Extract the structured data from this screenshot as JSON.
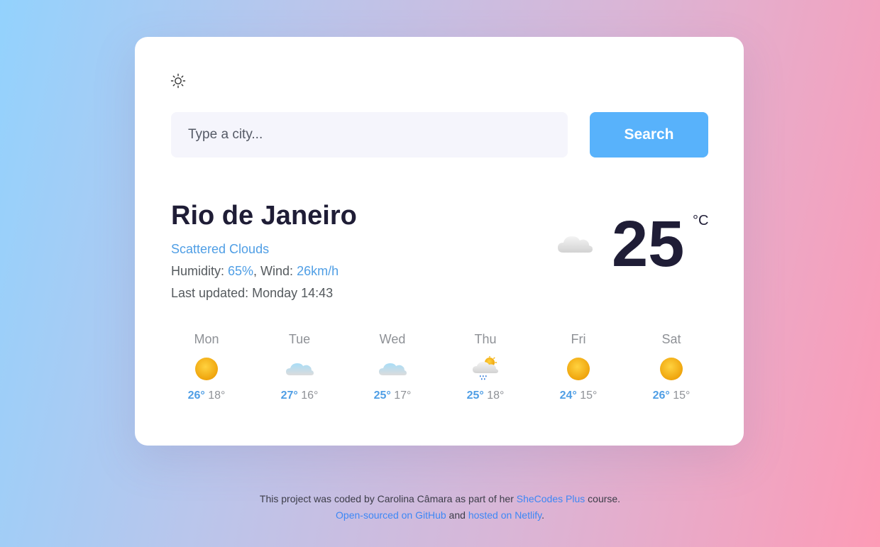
{
  "theme_toggle": {
    "icon": "sun-outline-icon"
  },
  "search": {
    "placeholder": "Type a city...",
    "button_label": "Search"
  },
  "current": {
    "city": "Rio de Janeiro",
    "description": "Scattered Clouds",
    "humidity_label": "Humidity: ",
    "humidity_value": "65%",
    "wind_label": ", Wind: ",
    "wind_value": "26km/h",
    "updated": "Last updated: Monday 14:43",
    "icon": "cloud-icon",
    "temperature": "25",
    "unit": "°C"
  },
  "forecast": [
    {
      "day": "Mon",
      "icon": "sun-icon",
      "max": "26°",
      "min": "18°"
    },
    {
      "day": "Tue",
      "icon": "cloud-icon",
      "max": "27°",
      "min": "16°"
    },
    {
      "day": "Wed",
      "icon": "cloud-icon",
      "max": "25°",
      "min": "17°"
    },
    {
      "day": "Thu",
      "icon": "sun-cloud-rain-icon",
      "max": "25°",
      "min": "18°"
    },
    {
      "day": "Fri",
      "icon": "sun-icon",
      "max": "24°",
      "min": "15°"
    },
    {
      "day": "Sat",
      "icon": "sun-icon",
      "max": "26°",
      "min": "15°"
    }
  ],
  "footer": {
    "line1_prefix": "This project was coded by Carolina Câmara as part of her ",
    "shecodes_link": "SheCodes Plus",
    "line1_suffix": " course.",
    "github_link": "Open-sourced on GitHub",
    "line2_middle": " and ",
    "netlify_link": "hosted on Netlify",
    "line2_suffix": "."
  },
  "colors": {
    "accent": "#58b2fb",
    "link": "#4f9ee5",
    "heading": "#1f1d36",
    "sun": "#f5b50f"
  }
}
